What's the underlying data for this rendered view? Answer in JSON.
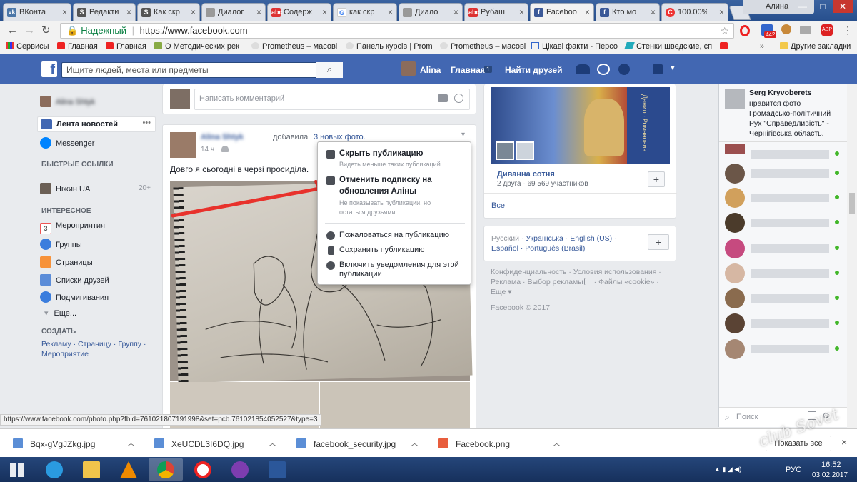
{
  "browser": {
    "tabs": [
      {
        "label": "ВКонта",
        "favicon": "vk-icon"
      },
      {
        "label": "Редакти",
        "favicon": "s-icon"
      },
      {
        "label": "Как скр",
        "favicon": "s-icon"
      },
      {
        "label": "Диалог",
        "favicon": "dialog-icon"
      },
      {
        "label": "Содерж",
        "favicon": "abc-icon"
      },
      {
        "label": "как скр",
        "favicon": "google-icon"
      },
      {
        "label": "Диало",
        "favicon": "dialog-icon"
      },
      {
        "label": "Рубаш",
        "favicon": "abc-icon"
      },
      {
        "label": "Faceboo",
        "favicon": "facebook-icon",
        "active": true
      },
      {
        "label": "Кто мо",
        "favicon": "facebook-icon"
      },
      {
        "label": "100.00%",
        "favicon": "copyright-icon"
      }
    ],
    "profile_name": "Алина",
    "address": {
      "secure_label": "Надежный",
      "url": "https://www.facebook.com"
    },
    "bookmarks": [
      {
        "label": "Сервисы",
        "icon": "apps-icon"
      },
      {
        "label": "Главная",
        "icon": "youtube-icon"
      },
      {
        "label": "Главная",
        "icon": "youtube-icon"
      },
      {
        "label": "О Методических рек",
        "icon": "flag-icon"
      },
      {
        "label": "Prometheus – масові",
        "icon": "bulb-icon"
      },
      {
        "label": "Панель курсів | Prom",
        "icon": "bulb-icon"
      },
      {
        "label": "Prometheus – масові",
        "icon": "bulb-icon"
      },
      {
        "label": "Цікаві факти - Персо",
        "icon": "page-icon"
      },
      {
        "label": "Стенки шведские, сп",
        "icon": "tool-icon"
      },
      {
        "label": "",
        "icon": "youtube-icon"
      }
    ],
    "other_bookmarks": "Другие закладки",
    "ext_badge": "442",
    "status_url": "https://www.facebook.com/photo.php?fbid=761021807191998&set=pcb.761021854052527&type=3"
  },
  "fb": {
    "search_placeholder": "Ищите людей, места или предметы",
    "user_name": "Alina",
    "home_label": "Главная",
    "home_count": "1",
    "find_friends": "Найти друзей",
    "left": {
      "profile_name": "Alina Shtyk",
      "news_feed": "Лента новостей",
      "messenger": "Messenger",
      "shortcuts_title": "БЫСТРЫЕ ССЫЛКИ",
      "shortcut": "Ніжин UA",
      "shortcut_count": "20+",
      "interesting_title": "ИНТЕРЕСНОЕ",
      "events": "Мероприятия",
      "events_date": "3",
      "groups": "Группы",
      "pages": "Страницы",
      "friend_lists": "Списки друзей",
      "pokes": "Подмигивания",
      "more": "Еще...",
      "create_title": "СОЗДАТЬ",
      "create_ad": "Рекламу",
      "create_page": "Страницу",
      "create_group": "Группу",
      "create_event": "Мероприятие",
      "sep": "·"
    },
    "composer_placeholder": "Написать комментарий",
    "post": {
      "author": "Alina Shtyk",
      "action": "добавила",
      "link": "3 новых фото.",
      "time": "14 ч",
      "text": "Довго я сьогодні в черзі просиділа."
    },
    "menu": {
      "hide_title": "Скрыть публикацию",
      "hide_sub": "Видеть меньше таких публикаций",
      "unfollow_title_1": "Отменить подписку на",
      "unfollow_title_2": "обновления Аліны",
      "unfollow_sub_1": "Не показывать публикации, но",
      "unfollow_sub_2": "остаться друзьями",
      "report": "Пожаловаться на публикацию",
      "save": "Сохранить публикацию",
      "notif_1": "Включить уведомления для этой",
      "notif_2": "публикации"
    },
    "group": {
      "name": "Диванна сотня",
      "meta": "2 друга · 69 569 участников",
      "all": "Все",
      "banner_text": "Данило Романович"
    },
    "languages": {
      "row1": [
        "Русский",
        "Українська",
        "English (US)"
      ],
      "row2": [
        "Español",
        "Português (Brasil)"
      ]
    },
    "footer": {
      "l1": "Конфиденциальность · Условия использования ·",
      "l2a": "Реклама · Выбор рекламы",
      "l2b": " · Файлы «cookie» ·",
      "l3": "Еще ▾",
      "copyright": "Facebook © 2017"
    },
    "ticker": {
      "name": "Serg Kryvoberets",
      "text": "нравится фото Громадсько-політичний Рух \"Справедливість\" - Чернігівська область."
    },
    "chat_search": "Поиск"
  },
  "downloads": {
    "items": [
      "Bqx-gVgJZkg.jpg",
      "XeUCDL3I6DQ.jpg",
      "facebook_security.jpg",
      "Facebook.png"
    ],
    "show_all": "Показать все"
  },
  "taskbar": {
    "lang": "РУС",
    "time": "16:52",
    "date": "03.02.2017"
  },
  "watermark": "club Sovet"
}
